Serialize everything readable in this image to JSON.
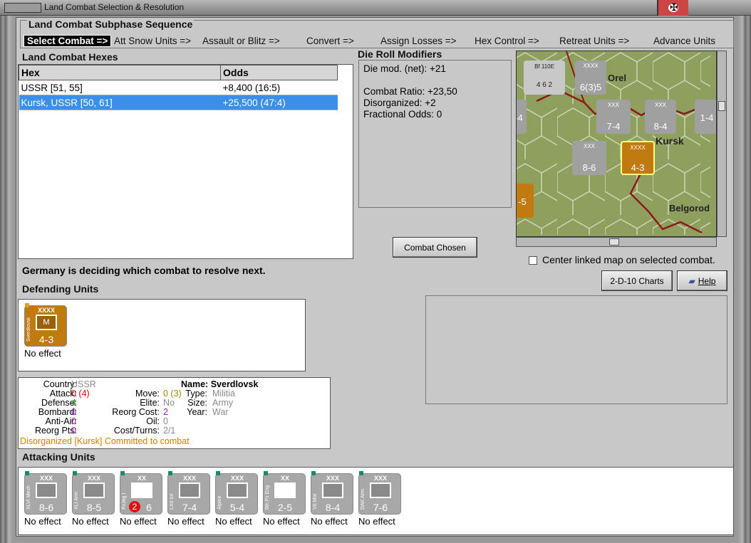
{
  "window": {
    "title": "Land Combat Selection & Resolution"
  },
  "sequence": {
    "title": "Land Combat Subphase Sequence",
    "steps": [
      "Select Combat =>",
      "Att Snow Units =>",
      "Assault or Blitz =>",
      "Convert =>",
      "Assign Losses =>",
      "Hex Control =>",
      "Retreat Units =>",
      "Advance Units"
    ]
  },
  "hexes": {
    "title": "Land Combat Hexes",
    "columns": [
      "Hex",
      "Odds"
    ],
    "rows": [
      {
        "hex": "USSR [51, 55]",
        "odds": "+8,400 (16:5)"
      },
      {
        "hex": "Kursk, USSR [50, 61]",
        "odds": "+25,500 (47:4)"
      }
    ]
  },
  "die": {
    "title": "Die Roll Modifiers",
    "net": "Die mod. (net): +21",
    "ratio": "Combat Ratio: +23,50",
    "disorg": "Disorganized: +2",
    "frac": "Fractional Odds: 0"
  },
  "map": {
    "labels": {
      "orel": "Orel",
      "kursk": "Kursk",
      "belgorod": "Belgorod"
    },
    "counters": [
      {
        "size": "Bf 110E",
        "str": "4 6 2",
        "top": "5"
      },
      {
        "size": "XXXX",
        "str": "6(3)5"
      },
      {
        "size": "XXX",
        "str": "7-4"
      },
      {
        "size": "XXX",
        "str": "8-4"
      },
      {
        "size": "",
        "str": "1-4"
      },
      {
        "size": "",
        "str": "-4"
      },
      {
        "size": "XXX",
        "str": "8-6"
      },
      {
        "size": "XXXX",
        "str": "4-3"
      },
      {
        "size": "",
        "str": "-5"
      }
    ]
  },
  "buttons": {
    "combat_chosen": "Combat Chosen",
    "charts": "2-D-10 Charts",
    "help": "Help"
  },
  "center_checkbox": {
    "label": "Center linked map on selected combat.",
    "checked": false
  },
  "status": "Germany is deciding which combat to resolve next.",
  "defending": {
    "title": "Defending Units",
    "unit": {
      "size": "XXXX",
      "name": "Sverdlovsk",
      "type_letter": "M",
      "strength": "4-3",
      "effect": "No effect"
    }
  },
  "info": {
    "country_label": "Country:",
    "country": "USSR",
    "attack_label": "Attack:",
    "attack": "0 (4)",
    "defense_label": "Defense:",
    "defense": "4",
    "bombard_label": "Bombard:",
    "bombard": "0",
    "antiair_label": "Anti-Air:",
    "antiair": "0",
    "reorg_label": "Reorg Pts:",
    "reorg": "0",
    "name_label": "Name:",
    "name": "Sverdlovsk",
    "move_label": "Move:",
    "move": "0 (3)",
    "elite_label": "Elite:",
    "elite": "No",
    "reorgcost_label": "Reorg Cost:",
    "reorgcost": "2",
    "oil_label": "Oil:",
    "oil": "0",
    "cost_label": "Cost/Turns:",
    "cost": "2/1",
    "type_label": "Type:",
    "type": "Militia",
    "size_label": "Size:",
    "size": "Army",
    "year_label": "Year:",
    "year": "War",
    "disorg": "Disorganized [Kursk]",
    "committed": "Committed to combat"
  },
  "attacking": {
    "title": "Attacking Units",
    "units": [
      {
        "size": "XXX",
        "name": "XLVI Mech",
        "strength": "8-6",
        "effect": "No effect"
      },
      {
        "size": "XXX",
        "name": "XLI Arm",
        "strength": "8-5",
        "effect": "No effect"
      },
      {
        "size": "XX",
        "name": "PzJeg I",
        "strength": "6",
        "effect": "No effect",
        "badge": "2"
      },
      {
        "size": "XXX",
        "name": "LXII Inf",
        "strength": "7-4",
        "effect": "No effect"
      },
      {
        "size": "XXX",
        "name": "Alpine",
        "strength": "5-4",
        "effect": "No effect"
      },
      {
        "size": "XX",
        "name": "6th Pz Eng",
        "strength": "2-5",
        "effect": "No effect"
      },
      {
        "size": "XXX",
        "name": "VII Mot",
        "strength": "8-4",
        "effect": "No effect"
      },
      {
        "size": "XXX",
        "name": "DAK Arm",
        "strength": "7-6",
        "effect": "No effect"
      }
    ]
  },
  "colors": {
    "selected_row": "#3a8fe8",
    "defender": "#c07a10",
    "attacker": "#a8a8a8",
    "attack_red": "#d01010",
    "defense_green": "#1a8a1a",
    "bombard_purple": "#a020c0",
    "reorg_cost_purple": "#a020c0",
    "disorg_orange": "#d08000",
    "committed_orange": "#d08000"
  }
}
